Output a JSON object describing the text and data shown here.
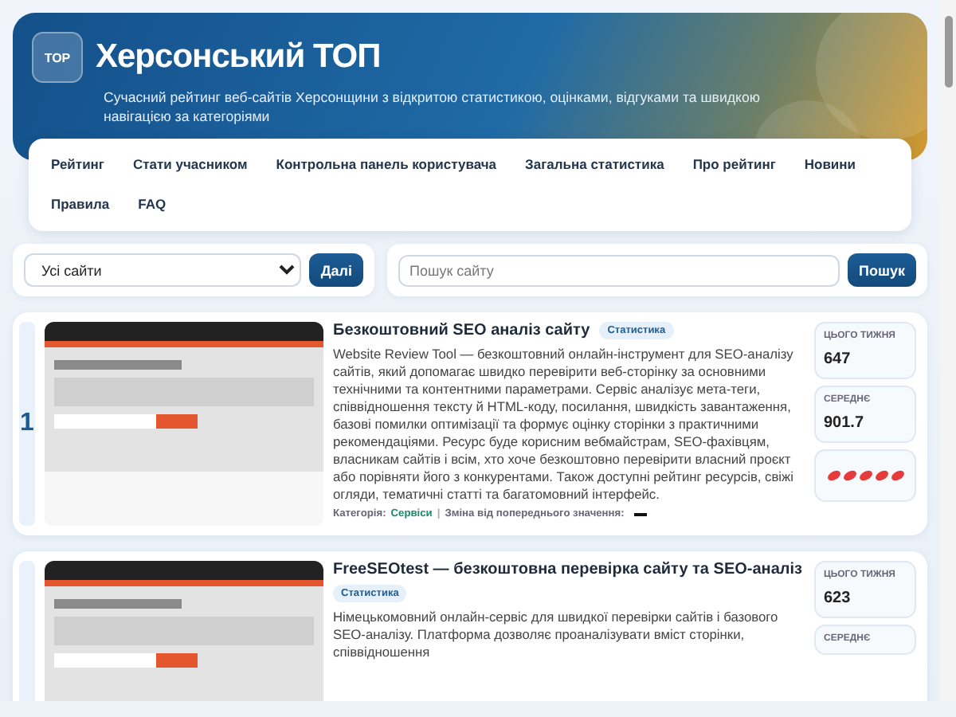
{
  "header": {
    "logo": "TOP",
    "title": "Херсонський ТОП",
    "subtitle": "Сучасний рейтинг веб-сайтів Херсонщини з відкритою статистикою, оцінками, відгуками та швидкою навігацією за категоріями"
  },
  "nav": [
    "Рейтинг",
    "Стати учасником",
    "Контрольна панель користувача",
    "Загальна статистика",
    "Про рейтинг",
    "Новини",
    "Правила",
    "FAQ"
  ],
  "filters": {
    "category_select": {
      "value": "Усі сайти"
    },
    "go_button": "Далі",
    "search": {
      "placeholder": "Пошук сайту"
    },
    "search_button": "Пошук"
  },
  "sites": [
    {
      "rank": "1",
      "title": "Безкоштовний SEO аналіз сайту",
      "badge": "Статистика",
      "description": "Website Review Tool — безкоштовний онлайн-інструмент для SEO-аналізу сайтів, який допомагає швидко перевірити веб-сторінку за основними технічними та контентними параметрами. Сервіс аналізує мета-теги, співвідношення тексту й HTML-коду, посилання, швидкість завантаження, базові помилки оптимізації та формує оцінку сторінки з практичними рекомендаціями. Ресурс буде корисним вебмайстрам, SEO-фахівцям, власникам сайтів і всім, хто хоче безкоштовно перевірити власний проєкт або порівняти його з конкурентами. Також доступні рейтинг ресурсів, свіжі огляди, тематичні статті та багатомовний інтерфейс.",
      "category_label": "Категорія:",
      "category": "Сервіси",
      "separator": "|",
      "change_label": "Зміна від попереднього значення:",
      "week_label": "ЦЬОГО ТИЖНЯ",
      "week": "647",
      "avg_label": "СЕРЕДНЄ",
      "avg": "901.7",
      "stars": 5
    },
    {
      "title": "FreeSEOtest — безкоштовна перевірка сайту та SEO-аналіз",
      "badge": "Статистика",
      "description": "Німецькомовний онлайн-сервіс для швидкої перевірки сайтів і базового SEO-аналізу. Платформа дозволяє проаналізувати вміст сторінки, співвідношення",
      "week_label": "ЦЬОГО ТИЖНЯ",
      "week": "623",
      "avg_label": "СЕРЕДНЄ"
    }
  ]
}
